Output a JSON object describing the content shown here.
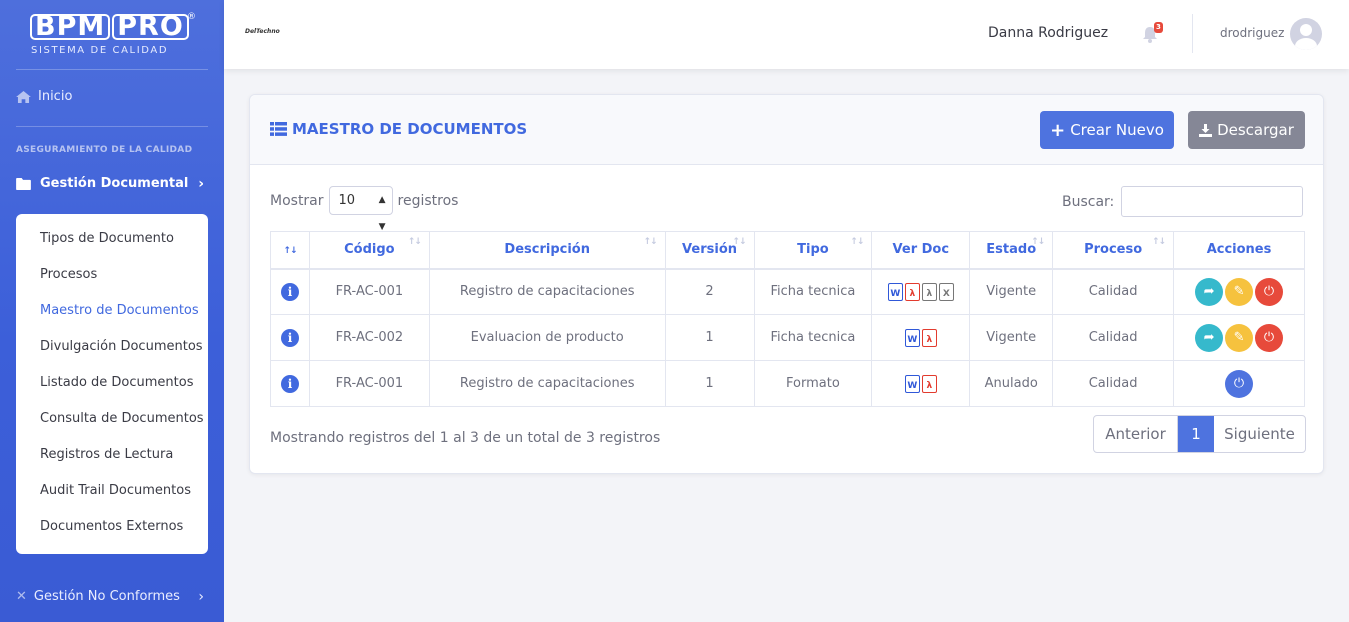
{
  "brand": {
    "name_a": "BPM",
    "name_b": "PRO",
    "reg": "®",
    "subtitle": "SISTEMA DE CALIDAD"
  },
  "sidebar": {
    "home": "Inicio",
    "heading": "ASEGURAMIENTO DE LA CALIDAD",
    "group": "Gestión Documental",
    "items": [
      {
        "label": "Tipos de Documento"
      },
      {
        "label": "Procesos"
      },
      {
        "label": "Maestro de Documentos"
      },
      {
        "label": "Divulgación Documentos"
      },
      {
        "label": "Listado de Documentos"
      },
      {
        "label": "Consulta de Documentos"
      },
      {
        "label": "Registros de Lectura"
      },
      {
        "label": "Audit Trail Documentos"
      },
      {
        "label": "Documentos Externos"
      }
    ],
    "bottom_group": "Gestión No Conformes"
  },
  "topbar": {
    "logo_text": "DelTechno",
    "user_name": "Danna Rodriguez",
    "notif_count": "3",
    "login": "drodriguez"
  },
  "card": {
    "title": "MAESTRO DE DOCUMENTOS",
    "btn_new": "Crear Nuevo",
    "btn_download": "Descargar"
  },
  "controls": {
    "show_label": "Mostrar",
    "show_value": "10",
    "show_suffix": "registros",
    "search_label": "Buscar:",
    "search_value": ""
  },
  "table": {
    "headers": [
      "",
      "Código",
      "Descripción",
      "Versión",
      "Tipo",
      "Ver Doc",
      "Estado",
      "Proceso",
      "Acciones"
    ],
    "rows": [
      {
        "code": "FR-AC-001",
        "desc": "Registro de capacitaciones",
        "version": "2",
        "type": "Ficha tecnica",
        "state": "Vigente",
        "process": "Calidad"
      },
      {
        "code": "FR-AC-002",
        "desc": "Evaluacion de producto",
        "version": "1",
        "type": "Ficha tecnica",
        "state": "Vigente",
        "process": "Calidad"
      },
      {
        "code": "FR-AC-001",
        "desc": "Registro de capacitaciones",
        "version": "1",
        "type": "Formato",
        "state": "Anulado",
        "process": "Calidad"
      }
    ]
  },
  "footer": {
    "info": "Mostrando registros del 1 al 3 de un total de 3 registros",
    "prev": "Anterior",
    "page": "1",
    "next": "Siguiente"
  },
  "colors": {
    "primary": "#4e73df",
    "sidebar": "#3c5fd9",
    "info": "#36b9cc",
    "warning": "#f6c23e",
    "danger": "#e74a3b",
    "secondary": "#858796"
  }
}
